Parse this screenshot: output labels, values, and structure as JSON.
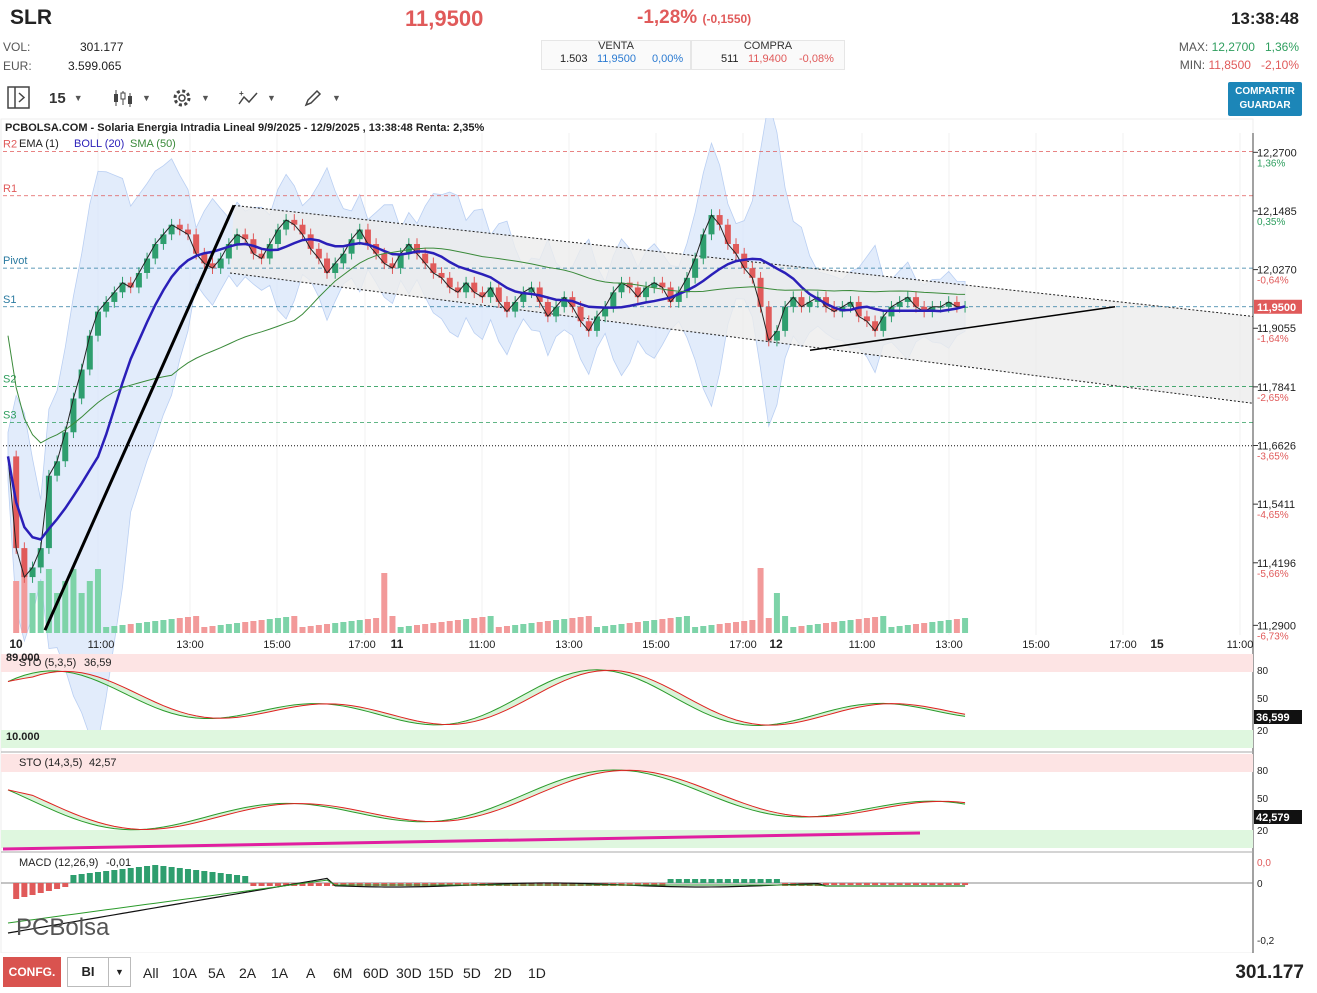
{
  "header": {
    "ticker": "SLR",
    "price": "11,9500",
    "change_pct": "-1,28%",
    "change_abs": "(-0,1550)",
    "time": "13:38:48",
    "vol_label": "VOL:",
    "vol": "301.177",
    "eur_label": "EUR:",
    "eur": "3.599.065",
    "venta_label": "VENTA",
    "venta_qty": "1.503",
    "venta_price": "11,9500",
    "venta_pct": "0,00%",
    "compra_label": "COMPRA",
    "compra_qty": "511",
    "compra_price": "11,9400",
    "compra_pct": "-0,08%",
    "max_label": "MAX:",
    "max": "12,2700",
    "max_pct": "1,36%",
    "min_label": "MIN:",
    "min": "11,8500",
    "min_pct": "-2,10%"
  },
  "toolbar": {
    "interval": "15",
    "share_line1": "COMPARTIR",
    "share_line2": "GUARDAR"
  },
  "chart": {
    "title": "PCBOLSA.COM - Solaria Energia Intradia Lineal 9/9/2025 - 12/9/2025 , 13:38:48 Renta: 2,35%",
    "legend_ema": "EMA (1)",
    "legend_boll": "BOLL (20)",
    "legend_sma": "SMA (50)",
    "levels": [
      "R2",
      "R1",
      "Pivot",
      "S1",
      "S2",
      "S3"
    ],
    "price_ticks": [
      "12,2700",
      "12,1485",
      "12,0270",
      "11,9055",
      "11,7841",
      "11,6626",
      "11,5411",
      "11,4196",
      "11,2900"
    ],
    "pct_ticks": [
      "1,36%",
      "0,35%",
      "-0,64%",
      "-1,64%",
      "-2,65%",
      "-3,65%",
      "-4,65%",
      "-5,66%",
      "-6,73%"
    ],
    "last_price": "11,9500",
    "time_labels": [
      "10",
      "11:00",
      "13:00",
      "15:00",
      "17:00",
      "11",
      "11:00",
      "13:00",
      "15:00",
      "17:00",
      "12",
      "11:00",
      "13:00",
      "15:00",
      "17:00",
      "15",
      "11:00"
    ],
    "colors": {
      "up": "#2e9e6e",
      "down": "#e05a5a",
      "boll": "#2a1fb8",
      "sma": "#3a8a3a",
      "band": "#dce8fb"
    }
  },
  "sto1": {
    "label": "STO (5,3,5)",
    "value": "36,59",
    "readout": "36,599",
    "vol_top": "89.000",
    "vol_bot": "10.000",
    "levels": [
      "80",
      "50",
      "20"
    ]
  },
  "sto2": {
    "label": "STO (14,3,5)",
    "value": "42,57",
    "readout": "42,579",
    "levels": [
      "80",
      "50",
      "20"
    ]
  },
  "macd": {
    "label": "MACD (12,26,9)",
    "value": "-0,01",
    "ticks": [
      "0,0",
      "0",
      "-0,2"
    ]
  },
  "logo": "PCBolsa",
  "footer": {
    "conf": "CONFG.",
    "mode": "BI",
    "periods": [
      "All",
      "10A",
      "5A",
      "2A",
      "1A",
      "A",
      "6M",
      "60D",
      "30D",
      "15D",
      "5D",
      "2D",
      "1D"
    ],
    "volume": "301.177"
  }
}
